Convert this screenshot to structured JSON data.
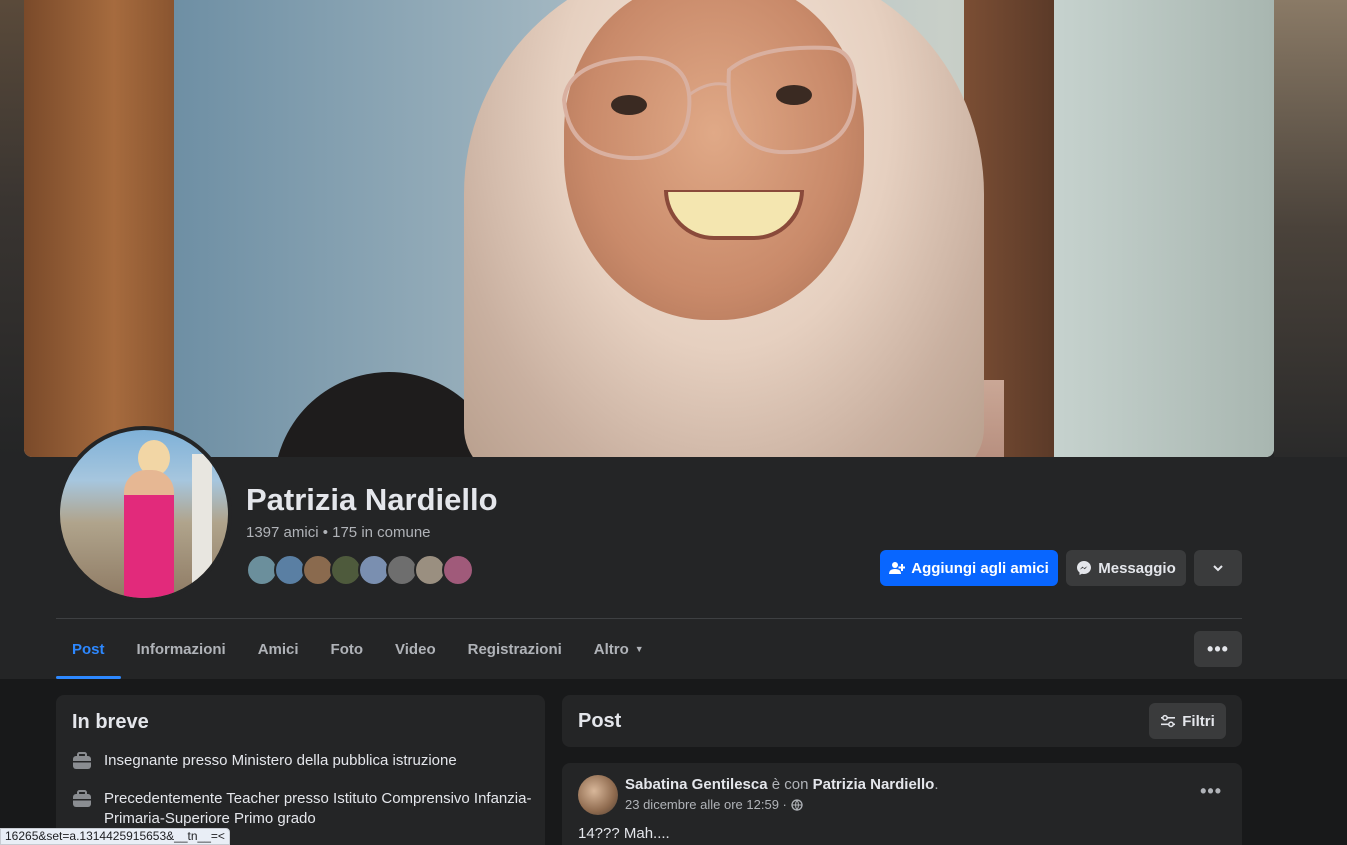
{
  "profile": {
    "name": "Patrizia Nardiello",
    "friends_summary": "1397 amici • 175 in comune",
    "friend_avatar_colors": [
      "#6b8f9c",
      "#5a7fa3",
      "#8a6a4e",
      "#4e5a3c",
      "#7a8fb0",
      "#6e6e6e",
      "#9a8f80",
      "#a05a7a"
    ]
  },
  "actions": {
    "add_friend": "Aggiungi agli amici",
    "message": "Messaggio",
    "more_icon": "chevron-down-icon"
  },
  "tabs": [
    {
      "label": "Post",
      "active": true
    },
    {
      "label": "Informazioni"
    },
    {
      "label": "Amici"
    },
    {
      "label": "Foto"
    },
    {
      "label": "Video"
    },
    {
      "label": "Registrazioni"
    },
    {
      "label": "Altro"
    }
  ],
  "intro": {
    "title": "In breve",
    "items": [
      "Insegnante presso Ministero della pubblica istruzione",
      "Precedentemente Teacher presso Istituto Comprensivo Infanzia-Primaria-Superiore Primo grado"
    ]
  },
  "posts_section": {
    "title": "Post",
    "filters_label": "Filtri"
  },
  "post": {
    "author": "Sabatina Gentilesca",
    "with_text": " è con ",
    "tagged": "Patrizia Nardiello",
    "suffix": ".",
    "date": "23 dicembre alle ore 12:59 ·",
    "text": "14??? Mah...."
  },
  "statusbar": {
    "url": "16265&set=a.1314425915653&__tn__=<"
  },
  "colors": {
    "accent": "#0866ff",
    "tab_active": "#2d88ff",
    "background": "#18191a",
    "card": "#242526"
  }
}
